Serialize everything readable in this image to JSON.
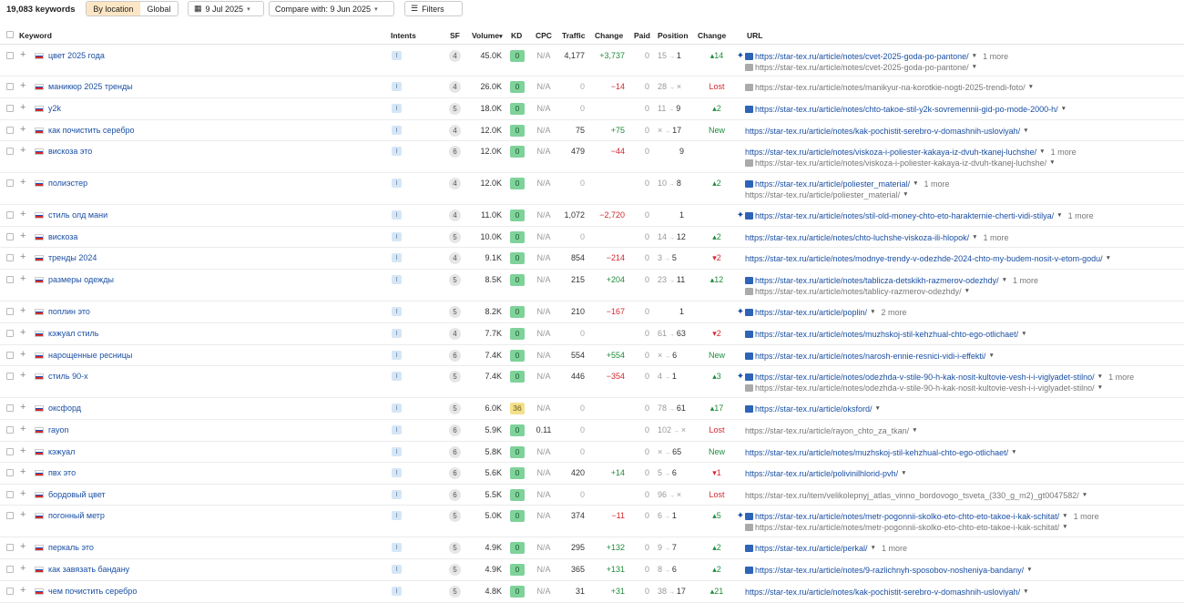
{
  "toolbar": {
    "keyword_count": "19,083 keywords",
    "by_location": "By location",
    "global": "Global",
    "date": "9 Jul 2025",
    "compare": "Compare with: 9 Jun 2025",
    "filters": "Filters"
  },
  "headers": {
    "keyword": "Keyword",
    "intents": "Intents",
    "sf": "SF",
    "volume": "Volume",
    "kd": "KD",
    "cpc": "CPC",
    "traffic": "Traffic",
    "change": "Change",
    "paid": "Paid",
    "position": "Position",
    "pos_change": "Change",
    "url": "URL"
  },
  "rows": [
    {
      "kw": "цвет 2025 года",
      "intent": "I",
      "sf": "4",
      "vol": "45.0K",
      "kd": "0",
      "kdc": "g",
      "cpc": "N/A",
      "traffic": "4,177",
      "tchg": "+3,737",
      "tcls": "pos",
      "paid": "0",
      "p1": "15",
      "p2": "1",
      "pchg": "▴14",
      "pcls": "up",
      "urls": [
        {
          "spark": true,
          "img": true,
          "text": "https://star-tex.ru/article/notes/cvet-2025-goda-po-pantone/",
          "more": "1 more"
        },
        {
          "spark": false,
          "img": "grey",
          "text": "https://star-tex.ru/article/notes/cvet-2025-goda-po-pantone/",
          "grey": true
        }
      ]
    },
    {
      "kw": "маникюр 2025 тренды",
      "intent": "I",
      "sf": "4",
      "vol": "26.0K",
      "kd": "0",
      "kdc": "g",
      "cpc": "N/A",
      "traffic": "0",
      "tchg": "−14",
      "tcls": "neg",
      "paid": "0",
      "p1": "28",
      "p2": "×",
      "pchg": "Lost",
      "pcls": "lost",
      "urls": [
        {
          "spark": false,
          "img": "grey",
          "text": "https://star-tex.ru/article/notes/manikyur-na-korotkie-nogti-2025-trendi-foto/",
          "grey": true
        }
      ]
    },
    {
      "kw": "y2k",
      "intent": "I",
      "sf": "5",
      "vol": "18.0K",
      "kd": "0",
      "kdc": "g",
      "cpc": "N/A",
      "traffic": "0",
      "tchg": "",
      "tcls": "",
      "paid": "0",
      "p1": "11",
      "p2": "9",
      "pchg": "▴2",
      "pcls": "up",
      "urls": [
        {
          "spark": false,
          "img": true,
          "text": "https://star-tex.ru/article/notes/chto-takoe-stil-y2k-sovremennii-gid-po-mode-2000-h/"
        }
      ]
    },
    {
      "kw": "как почистить серебро",
      "intent": "I",
      "sf": "4",
      "vol": "12.0K",
      "kd": "0",
      "kdc": "g",
      "cpc": "N/A",
      "traffic": "75",
      "tchg": "+75",
      "tcls": "pos",
      "paid": "0",
      "p1": "×",
      "p2": "17",
      "pchg": "New",
      "pcls": "new",
      "urls": [
        {
          "spark": false,
          "img": false,
          "text": "https://star-tex.ru/article/notes/kak-pochistit-serebro-v-domashnih-usloviyah/"
        }
      ]
    },
    {
      "kw": "вискоза это",
      "intent": "I",
      "sf": "6",
      "vol": "12.0K",
      "kd": "0",
      "kdc": "g",
      "cpc": "N/A",
      "traffic": "479",
      "tchg": "−44",
      "tcls": "neg",
      "paid": "0",
      "p1": "",
      "p2": "9",
      "pchg": "",
      "pcls": "",
      "urls": [
        {
          "spark": false,
          "img": false,
          "text": "https://star-tex.ru/article/notes/viskoza-i-poliester-kakaya-iz-dvuh-tkanej-luchshe/",
          "more": "1 more"
        },
        {
          "spark": false,
          "img": "grey",
          "text": "https://star-tex.ru/article/notes/viskoza-i-poliester-kakaya-iz-dvuh-tkanej-luchshe/",
          "grey": true
        }
      ]
    },
    {
      "kw": "полиэстер",
      "intent": "I",
      "sf": "4",
      "vol": "12.0K",
      "kd": "0",
      "kdc": "g",
      "cpc": "N/A",
      "traffic": "0",
      "tchg": "",
      "tcls": "",
      "paid": "0",
      "p1": "10",
      "p2": "8",
      "pchg": "▴2",
      "pcls": "up",
      "urls": [
        {
          "spark": false,
          "img": true,
          "text": "https://star-tex.ru/article/poliester_material/",
          "more": "1 more"
        },
        {
          "spark": false,
          "img": false,
          "text": "https://star-tex.ru/article/poliester_material/",
          "grey": true
        }
      ]
    },
    {
      "kw": "стиль олд мани",
      "intent": "I",
      "sf": "4",
      "vol": "11.0K",
      "kd": "0",
      "kdc": "g",
      "cpc": "N/A",
      "traffic": "1,072",
      "tchg": "−2,720",
      "tcls": "neg",
      "paid": "0",
      "p1": "",
      "p2": "1",
      "pchg": "",
      "pcls": "",
      "urls": [
        {
          "spark": true,
          "img": true,
          "text": "https://star-tex.ru/article/notes/stil-old-money-chto-eto-harakternie-cherti-vidi-stilya/",
          "more": "1 more"
        }
      ]
    },
    {
      "kw": "вискоза",
      "intent": "I",
      "sf": "5",
      "vol": "10.0K",
      "kd": "0",
      "kdc": "g",
      "cpc": "N/A",
      "traffic": "0",
      "tchg": "",
      "tcls": "",
      "paid": "0",
      "p1": "14",
      "p2": "12",
      "pchg": "▴2",
      "pcls": "up",
      "urls": [
        {
          "spark": false,
          "img": false,
          "text": "https://star-tex.ru/article/notes/chto-luchshe-viskoza-ili-hlopok/",
          "more": "1 more"
        }
      ]
    },
    {
      "kw": "тренды 2024",
      "intent": "I",
      "sf": "4",
      "vol": "9.1K",
      "kd": "0",
      "kdc": "g",
      "cpc": "N/A",
      "traffic": "854",
      "tchg": "−214",
      "tcls": "neg",
      "paid": "0",
      "p1": "3",
      "p2": "5",
      "pchg": "▾2",
      "pcls": "dn",
      "urls": [
        {
          "spark": false,
          "img": false,
          "text": "https://star-tex.ru/article/notes/modnye-trendy-v-odezhde-2024-chto-my-budem-nosit-v-etom-godu/"
        }
      ]
    },
    {
      "kw": "размеры одежды",
      "intent": "I",
      "sf": "5",
      "vol": "8.5K",
      "kd": "0",
      "kdc": "g",
      "cpc": "N/A",
      "traffic": "215",
      "tchg": "+204",
      "tcls": "pos",
      "paid": "0",
      "p1": "23",
      "p2": "11",
      "pchg": "▴12",
      "pcls": "up",
      "urls": [
        {
          "spark": false,
          "img": true,
          "text": "https://star-tex.ru/article/notes/tablicza-detskikh-razmerov-odezhdy/",
          "more": "1 more"
        },
        {
          "spark": false,
          "img": "grey",
          "text": "https://star-tex.ru/article/notes/tablicy-razmerov-odezhdy/",
          "grey": true
        }
      ]
    },
    {
      "kw": "поплин это",
      "intent": "I",
      "sf": "5",
      "vol": "8.2K",
      "kd": "0",
      "kdc": "g",
      "cpc": "N/A",
      "traffic": "210",
      "tchg": "−167",
      "tcls": "neg",
      "paid": "0",
      "p1": "",
      "p2": "1",
      "pchg": "",
      "pcls": "",
      "urls": [
        {
          "spark": true,
          "img": true,
          "text": "https://star-tex.ru/article/poplin/",
          "more": "2 more"
        }
      ]
    },
    {
      "kw": "кэжуал стиль",
      "intent": "I",
      "sf": "4",
      "vol": "7.7K",
      "kd": "0",
      "kdc": "g",
      "cpc": "N/A",
      "traffic": "0",
      "tchg": "",
      "tcls": "",
      "paid": "0",
      "p1": "61",
      "p2": "63",
      "pchg": "▾2",
      "pcls": "dn",
      "urls": [
        {
          "spark": false,
          "img": true,
          "text": "https://star-tex.ru/article/notes/muzhskoj-stil-kehzhual-chto-ego-otlichaet/"
        }
      ]
    },
    {
      "kw": "нарощенные ресницы",
      "intent": "I",
      "sf": "6",
      "vol": "7.4K",
      "kd": "0",
      "kdc": "g",
      "cpc": "N/A",
      "traffic": "554",
      "tchg": "+554",
      "tcls": "pos",
      "paid": "0",
      "p1": "×",
      "p2": "6",
      "pchg": "New",
      "pcls": "new",
      "urls": [
        {
          "spark": false,
          "img": true,
          "text": "https://star-tex.ru/article/notes/narosh-ennie-resnici-vidi-i-effekti/"
        }
      ]
    },
    {
      "kw": "стиль 90-х",
      "intent": "I",
      "sf": "5",
      "vol": "7.4K",
      "kd": "0",
      "kdc": "g",
      "cpc": "N/A",
      "traffic": "446",
      "tchg": "−354",
      "tcls": "neg",
      "paid": "0",
      "p1": "4",
      "p2": "1",
      "pchg": "▴3",
      "pcls": "up",
      "urls": [
        {
          "spark": true,
          "img": true,
          "text": "https://star-tex.ru/article/notes/odezhda-v-stile-90-h-kak-nosit-kultovie-vesh-i-i-viglyadet-stilno/",
          "more": "1 more"
        },
        {
          "spark": false,
          "img": "grey",
          "text": "https://star-tex.ru/article/notes/odezhda-v-stile-90-h-kak-nosit-kultovie-vesh-i-i-viglyadet-stilno/",
          "grey": true
        }
      ]
    },
    {
      "kw": "оксфорд",
      "intent": "I",
      "sf": "5",
      "vol": "6.0K",
      "kd": "36",
      "kdc": "y",
      "cpc": "N/A",
      "traffic": "0",
      "tchg": "",
      "tcls": "",
      "paid": "0",
      "p1": "78",
      "p2": "61",
      "pchg": "▴17",
      "pcls": "up",
      "urls": [
        {
          "spark": false,
          "img": true,
          "text": "https://star-tex.ru/article/oksford/"
        }
      ]
    },
    {
      "kw": "rayon",
      "intent": "I",
      "sf": "6",
      "vol": "5.9K",
      "kd": "0",
      "kdc": "g",
      "cpc": "0.11",
      "traffic": "0",
      "tchg": "",
      "tcls": "",
      "paid": "0",
      "p1": "102",
      "p2": "×",
      "pchg": "Lost",
      "pcls": "lost",
      "urls": [
        {
          "spark": false,
          "img": false,
          "text": "https://star-tex.ru/article/rayon_chto_za_tkan/",
          "grey": true
        }
      ]
    },
    {
      "kw": "кэжуал",
      "intent": "I",
      "sf": "6",
      "vol": "5.8K",
      "kd": "0",
      "kdc": "g",
      "cpc": "N/A",
      "traffic": "0",
      "tchg": "",
      "tcls": "",
      "paid": "0",
      "p1": "×",
      "p2": "65",
      "pchg": "New",
      "pcls": "new",
      "urls": [
        {
          "spark": false,
          "img": false,
          "text": "https://star-tex.ru/article/notes/muzhskoj-stil-kehzhual-chto-ego-otlichaet/"
        }
      ]
    },
    {
      "kw": "пвх это",
      "intent": "I",
      "sf": "6",
      "vol": "5.6K",
      "kd": "0",
      "kdc": "g",
      "cpc": "N/A",
      "traffic": "420",
      "tchg": "+14",
      "tcls": "pos",
      "paid": "0",
      "p1": "5",
      "p2": "6",
      "pchg": "▾1",
      "pcls": "dn",
      "urls": [
        {
          "spark": false,
          "img": false,
          "text": "https://star-tex.ru/article/polivinilhlorid-pvh/"
        }
      ]
    },
    {
      "kw": "бордовый цвет",
      "intent": "I",
      "sf": "6",
      "vol": "5.5K",
      "kd": "0",
      "kdc": "g",
      "cpc": "N/A",
      "traffic": "0",
      "tchg": "",
      "tcls": "",
      "paid": "0",
      "p1": "96",
      "p2": "×",
      "pchg": "Lost",
      "pcls": "lost",
      "urls": [
        {
          "spark": false,
          "img": false,
          "text": "https://star-tex.ru/item/velikolepnyj_atlas_vinno_bordovogo_tsveta_(330_g_m2)_gt0047582/",
          "grey": true
        }
      ]
    },
    {
      "kw": "погонный метр",
      "intent": "I",
      "sf": "5",
      "vol": "5.0K",
      "kd": "0",
      "kdc": "g",
      "cpc": "N/A",
      "traffic": "374",
      "tchg": "−11",
      "tcls": "neg",
      "paid": "0",
      "p1": "6",
      "p2": "1",
      "pchg": "▴5",
      "pcls": "up",
      "urls": [
        {
          "spark": true,
          "img": true,
          "text": "https://star-tex.ru/article/notes/metr-pogonnii-skolko-eto-chto-eto-takoe-i-kak-schitat/",
          "more": "1 more"
        },
        {
          "spark": false,
          "img": "grey",
          "text": "https://star-tex.ru/article/notes/metr-pogonnii-skolko-eto-chto-eto-takoe-i-kak-schitat/",
          "grey": true
        }
      ]
    },
    {
      "kw": "перкаль это",
      "intent": "I",
      "sf": "5",
      "vol": "4.9K",
      "kd": "0",
      "kdc": "g",
      "cpc": "N/A",
      "traffic": "295",
      "tchg": "+132",
      "tcls": "pos",
      "paid": "0",
      "p1": "9",
      "p2": "7",
      "pchg": "▴2",
      "pcls": "up",
      "urls": [
        {
          "spark": false,
          "img": true,
          "text": "https://star-tex.ru/article/perkal/",
          "more": "1 more"
        }
      ]
    },
    {
      "kw": "как завязать бандану",
      "intent": "I",
      "sf": "5",
      "vol": "4.9K",
      "kd": "0",
      "kdc": "g",
      "cpc": "N/A",
      "traffic": "365",
      "tchg": "+131",
      "tcls": "pos",
      "paid": "0",
      "p1": "8",
      "p2": "6",
      "pchg": "▴2",
      "pcls": "up",
      "urls": [
        {
          "spark": false,
          "img": true,
          "text": "https://star-tex.ru/article/notes/9-razlichnyh-sposobov-nosheniya-bandany/"
        }
      ]
    },
    {
      "kw": "чем почистить серебро",
      "intent": "I",
      "sf": "5",
      "vol": "4.8K",
      "kd": "0",
      "kdc": "g",
      "cpc": "N/A",
      "traffic": "31",
      "tchg": "+31",
      "tcls": "pos",
      "paid": "0",
      "p1": "38",
      "p2": "17",
      "pchg": "▴21",
      "pcls": "up",
      "urls": [
        {
          "spark": false,
          "img": false,
          "text": "https://star-tex.ru/article/notes/kak-pochistit-serebro-v-domashnih-usloviyah/"
        }
      ]
    }
  ]
}
